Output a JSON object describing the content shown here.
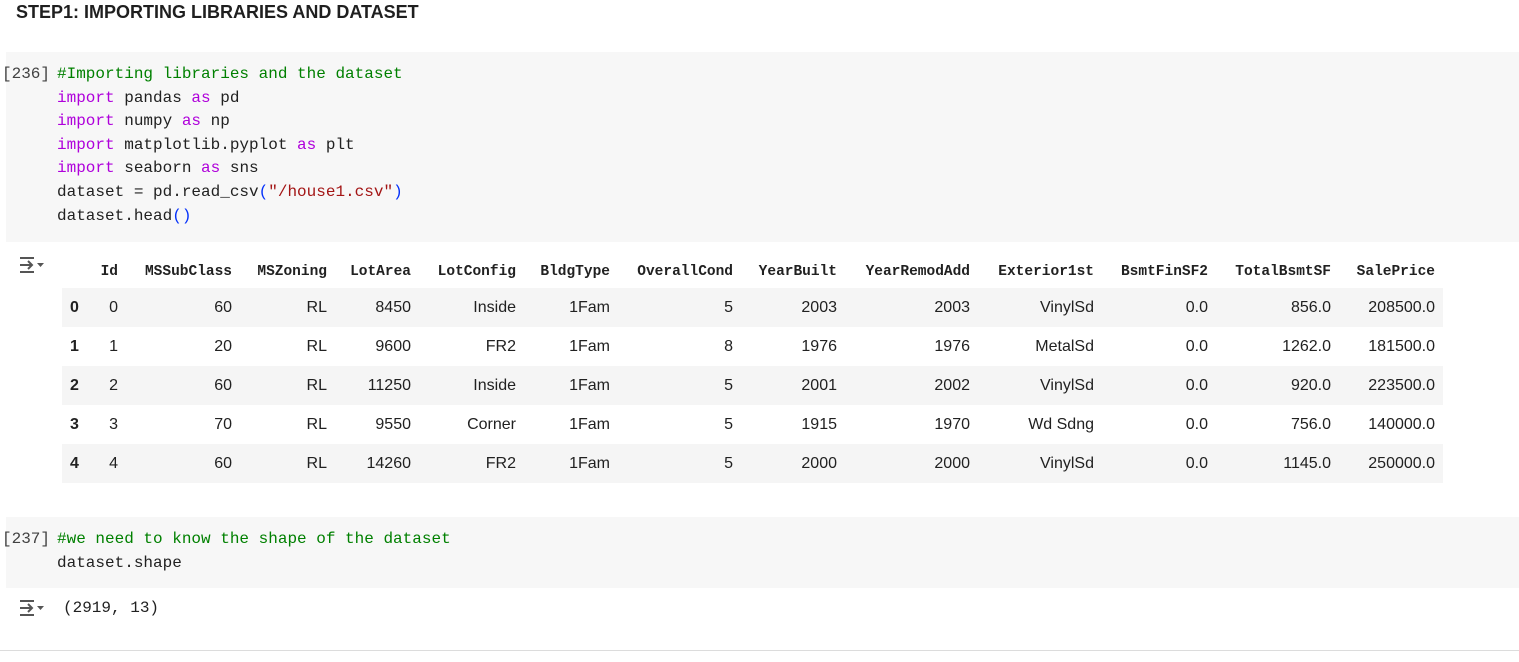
{
  "heading": "STEP1: IMPORTING LIBRARIES AND DATASET",
  "cell1": {
    "prompt": "[236]",
    "comment": "#Importing libraries and the dataset",
    "lines": [
      [
        "import",
        " pandas ",
        "as",
        " pd"
      ],
      [
        "import",
        " numpy ",
        "as",
        " np"
      ],
      [
        "import",
        " matplotlib.pyplot ",
        "as",
        " plt"
      ],
      [
        "import",
        " seaborn ",
        "as",
        " sns"
      ]
    ],
    "read_prefix": "dataset = pd.read_csv",
    "read_arg": "\"/house1.csv\"",
    "head_prefix": "dataset.head",
    "paren_open": "(",
    "paren_close": ")",
    "empty_parens": "()"
  },
  "table": {
    "columns": [
      "",
      "Id",
      "MSSubClass",
      "MSZoning",
      "LotArea",
      "LotConfig",
      "BldgType",
      "OverallCond",
      "YearBuilt",
      "YearRemodAdd",
      "Exterior1st",
      "BsmtFinSF2",
      "TotalBsmtSF",
      "SalePrice"
    ],
    "rows": [
      [
        "0",
        "0",
        "60",
        "RL",
        "8450",
        "Inside",
        "1Fam",
        "5",
        "2003",
        "2003",
        "VinylSd",
        "0.0",
        "856.0",
        "208500.0"
      ],
      [
        "1",
        "1",
        "20",
        "RL",
        "9600",
        "FR2",
        "1Fam",
        "8",
        "1976",
        "1976",
        "MetalSd",
        "0.0",
        "1262.0",
        "181500.0"
      ],
      [
        "2",
        "2",
        "60",
        "RL",
        "11250",
        "Inside",
        "1Fam",
        "5",
        "2001",
        "2002",
        "VinylSd",
        "0.0",
        "920.0",
        "223500.0"
      ],
      [
        "3",
        "3",
        "70",
        "RL",
        "9550",
        "Corner",
        "1Fam",
        "5",
        "1915",
        "1970",
        "Wd Sdng",
        "0.0",
        "756.0",
        "140000.0"
      ],
      [
        "4",
        "4",
        "60",
        "RL",
        "14260",
        "FR2",
        "1Fam",
        "5",
        "2000",
        "2000",
        "VinylSd",
        "0.0",
        "1145.0",
        "250000.0"
      ]
    ]
  },
  "cell2": {
    "prompt": "[237]",
    "comment": "#we need to know the shape of the dataset",
    "code": "dataset.shape",
    "output": "(2919, 13)"
  }
}
